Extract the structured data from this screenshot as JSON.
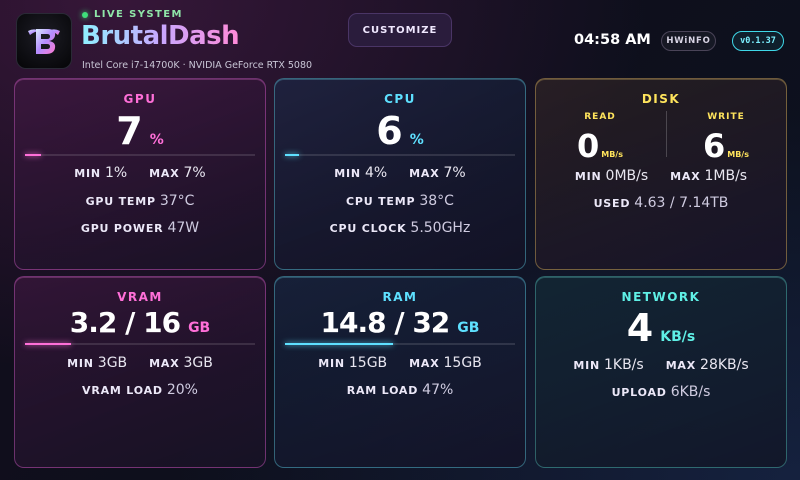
{
  "header": {
    "live_label": "LIVE SYSTEM",
    "brand": "BrutalDash",
    "hardware": "Intel Core i7-14700K · NVIDIA GeForce RTX 5080",
    "customize_label": "CUSTOMIZE",
    "time": "04:58 AM",
    "hwinfo_label": "HWiNFO",
    "version": "v0.1.37"
  },
  "colors": {
    "magenta": "#ff6fd8",
    "cyan": "#5ee0ff",
    "gold": "#ffe45c",
    "teal": "#5ff0e6",
    "live": "#3fe07a"
  },
  "gpu": {
    "title": "GPU",
    "value": "7",
    "unit": "%",
    "bar_percent": 7,
    "min_label": "MIN",
    "min": "1%",
    "max_label": "MAX",
    "max": "7%",
    "temp_label": "GPU TEMP",
    "temp": "37°C",
    "power_label": "GPU POWER",
    "power": "47W"
  },
  "cpu": {
    "title": "CPU",
    "value": "6",
    "unit": "%",
    "bar_percent": 6,
    "min_label": "MIN",
    "min": "4%",
    "max_label": "MAX",
    "max": "7%",
    "temp_label": "CPU TEMP",
    "temp": "38°C",
    "clock_label": "CPU CLOCK",
    "clock": "5.50GHz"
  },
  "disk": {
    "title": "DISK",
    "read_label": "READ",
    "read": "0",
    "read_unit": "MB/s",
    "write_label": "WRITE",
    "write": "6",
    "write_unit": "MB/s",
    "min_label": "MIN",
    "min": "0MB/s",
    "max_label": "MAX",
    "max": "1MB/s",
    "used_label": "USED",
    "used": "4.63 / 7.14TB"
  },
  "vram": {
    "title": "VRAM",
    "value": "3.2 / 16",
    "unit": "GB",
    "bar_percent": 20,
    "min_label": "MIN",
    "min": "3GB",
    "max_label": "MAX",
    "max": "3GB",
    "load_label": "VRAM LOAD",
    "load": "20%"
  },
  "ram": {
    "title": "RAM",
    "value": "14.8 / 32",
    "unit": "GB",
    "bar_percent": 47,
    "min_label": "MIN",
    "min": "15GB",
    "max_label": "MAX",
    "max": "15GB",
    "load_label": "RAM LOAD",
    "load": "47%"
  },
  "network": {
    "title": "NETWORK",
    "value": "4",
    "unit": "KB/s",
    "min_label": "MIN",
    "min": "1KB/s",
    "max_label": "MAX",
    "max": "28KB/s",
    "upload_label": "UPLOAD",
    "upload": "6KB/s"
  }
}
